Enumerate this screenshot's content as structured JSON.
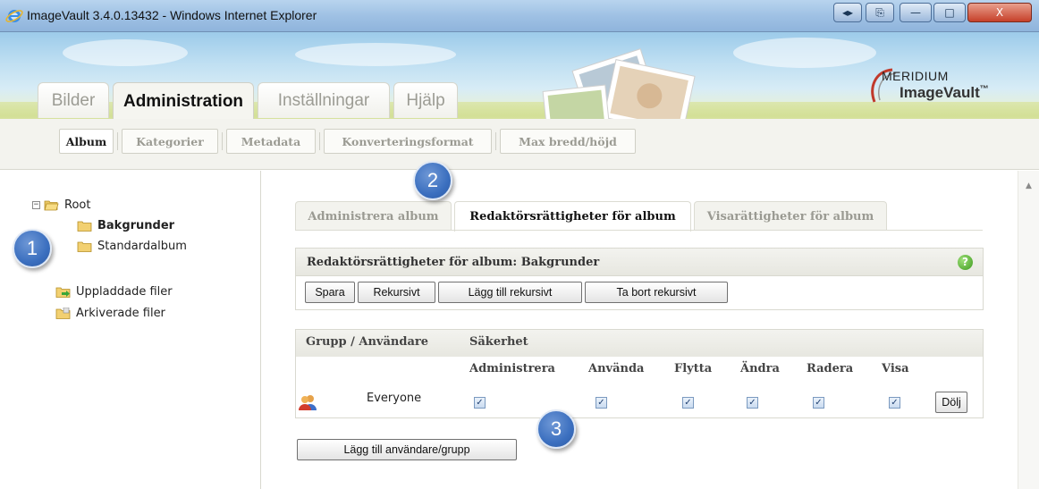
{
  "window": {
    "title": "ImageVault 3.4.0.13432 - Windows Internet Explorer",
    "controls": {
      "compat": "◂▸",
      "page": "⎘",
      "minimize": "—",
      "maximize": "□",
      "close": "X"
    }
  },
  "logo": {
    "line1": "MERIDIUM",
    "line2": "ImageVault",
    "tm": "™"
  },
  "main_tabs": [
    "Bilder",
    "Administration",
    "Inställningar",
    "Hjälp"
  ],
  "sub_tabs": [
    "Album",
    "Kategorier",
    "Metadata",
    "Konverteringsformat",
    "Max bredd/höjd"
  ],
  "tree": {
    "root": "Root",
    "expander": "−",
    "children": [
      "Bakgrunder",
      "Standardalbum"
    ],
    "special": [
      "Uppladdade filer",
      "Arkiverade filer"
    ]
  },
  "right_tabs": [
    "Administrera album",
    "Redaktörsrättigheter för album",
    "Visarättigheter för album"
  ],
  "panel": {
    "title": "Redaktörsrättigheter för album: Bakgrunder",
    "help": "?",
    "buttons": [
      "Spara",
      "Rekursivt",
      "Lägg till rekursivt",
      "Ta bort rekursivt"
    ]
  },
  "grid": {
    "col_user": "Grupp / Användare",
    "col_security": "Säkerhet",
    "permissions": [
      "Administrera",
      "Använda",
      "Flytta",
      "Ändra",
      "Radera",
      "Visa"
    ],
    "rows": [
      {
        "name": "Everyone",
        "checks": [
          "✓",
          "✓",
          "✓",
          "✓",
          "✓",
          "✓"
        ],
        "action": "Dölj"
      }
    ]
  },
  "add_button": "Lägg till användare/grupp",
  "callouts": [
    "1",
    "2",
    "3"
  ],
  "colors": {
    "callout": "#3b6fbf",
    "title_bar": "#9fc1e4",
    "help": "#3c9a1c"
  }
}
